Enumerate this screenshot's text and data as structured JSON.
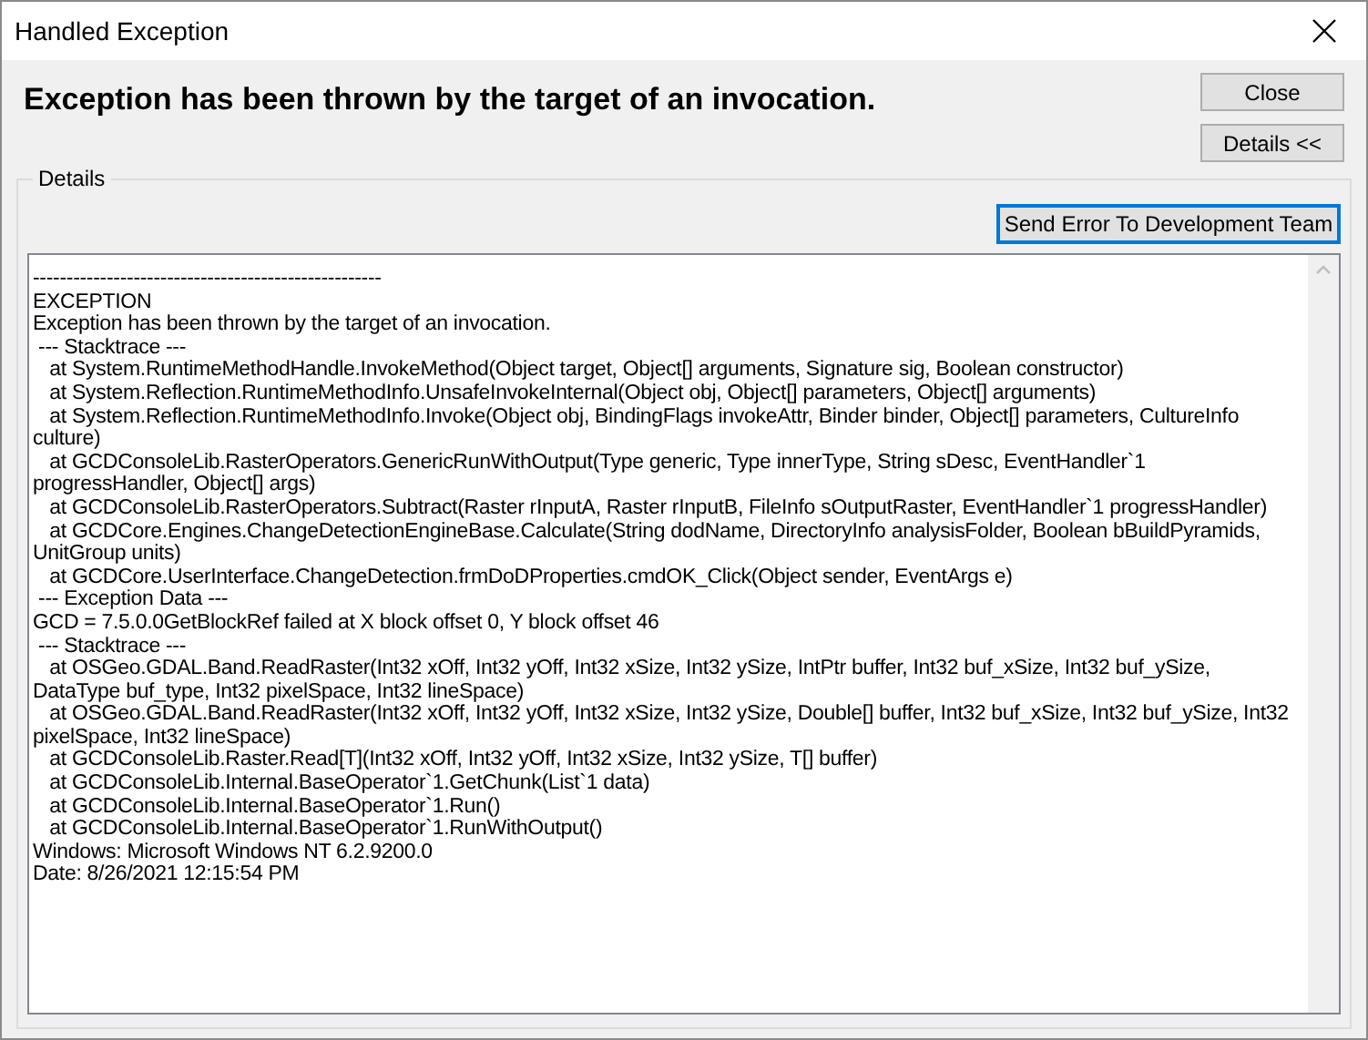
{
  "window": {
    "title": "Handled Exception"
  },
  "heading": "Exception has been thrown by the target of an invocation.",
  "buttons": [
    {
      "label": "Close",
      "focused": false
    },
    {
      "label": "Details <<",
      "focused": false
    }
  ],
  "details": {
    "title": "Details",
    "send_button": {
      "label": "Send Error To Development Team",
      "focused": true
    },
    "lines": [
      "----------------------------------------------------",
      "EXCEPTION",
      "Exception has been thrown by the target of an invocation.",
      " --- Stacktrace ---",
      "   at System.RuntimeMethodHandle.InvokeMethod(Object target, Object[] arguments, Signature sig, Boolean constructor)",
      "   at System.Reflection.RuntimeMethodInfo.UnsafeInvokeInternal(Object obj, Object[] parameters, Object[] arguments)",
      "   at System.Reflection.RuntimeMethodInfo.Invoke(Object obj, BindingFlags invokeAttr, Binder binder, Object[] parameters, CultureInfo culture)",
      "   at GCDConsoleLib.RasterOperators.GenericRunWithOutput(Type generic, Type innerType, String sDesc, EventHandler`1 progressHandler, Object[] args)",
      "   at GCDConsoleLib.RasterOperators.Subtract(Raster rInputA, Raster rInputB, FileInfo sOutputRaster, EventHandler`1 progressHandler)",
      "   at GCDCore.Engines.ChangeDetectionEngineBase.Calculate(String dodName, DirectoryInfo analysisFolder, Boolean bBuildPyramids, UnitGroup units)",
      "   at GCDCore.UserInterface.ChangeDetection.frmDoDProperties.cmdOK_Click(Object sender, EventArgs e)",
      " --- Exception Data ---",
      "GCD = 7.5.0.0GetBlockRef failed at X block offset 0, Y block offset 46",
      " --- Stacktrace ---",
      "   at OSGeo.GDAL.Band.ReadRaster(Int32 xOff, Int32 yOff, Int32 xSize, Int32 ySize, IntPtr buffer, Int32 buf_xSize, Int32 buf_ySize, DataType buf_type, Int32 pixelSpace, Int32 lineSpace)",
      "   at OSGeo.GDAL.Band.ReadRaster(Int32 xOff, Int32 yOff, Int32 xSize, Int32 ySize, Double[] buffer, Int32 buf_xSize, Int32 buf_ySize, Int32 pixelSpace, Int32 lineSpace)",
      "   at GCDConsoleLib.Raster.Read[T](Int32 xOff, Int32 yOff, Int32 xSize, Int32 ySize, T[] buffer)",
      "   at GCDConsoleLib.Internal.BaseOperator`1.GetChunk(List`1 data)",
      "   at GCDConsoleLib.Internal.BaseOperator`1.Run()",
      "   at GCDConsoleLib.Internal.BaseOperator`1.RunWithOutput()",
      "Windows: Microsoft Windows NT 6.2.9200.0",
      "Date: 8/26/2021 12:15:54 PM"
    ]
  }
}
